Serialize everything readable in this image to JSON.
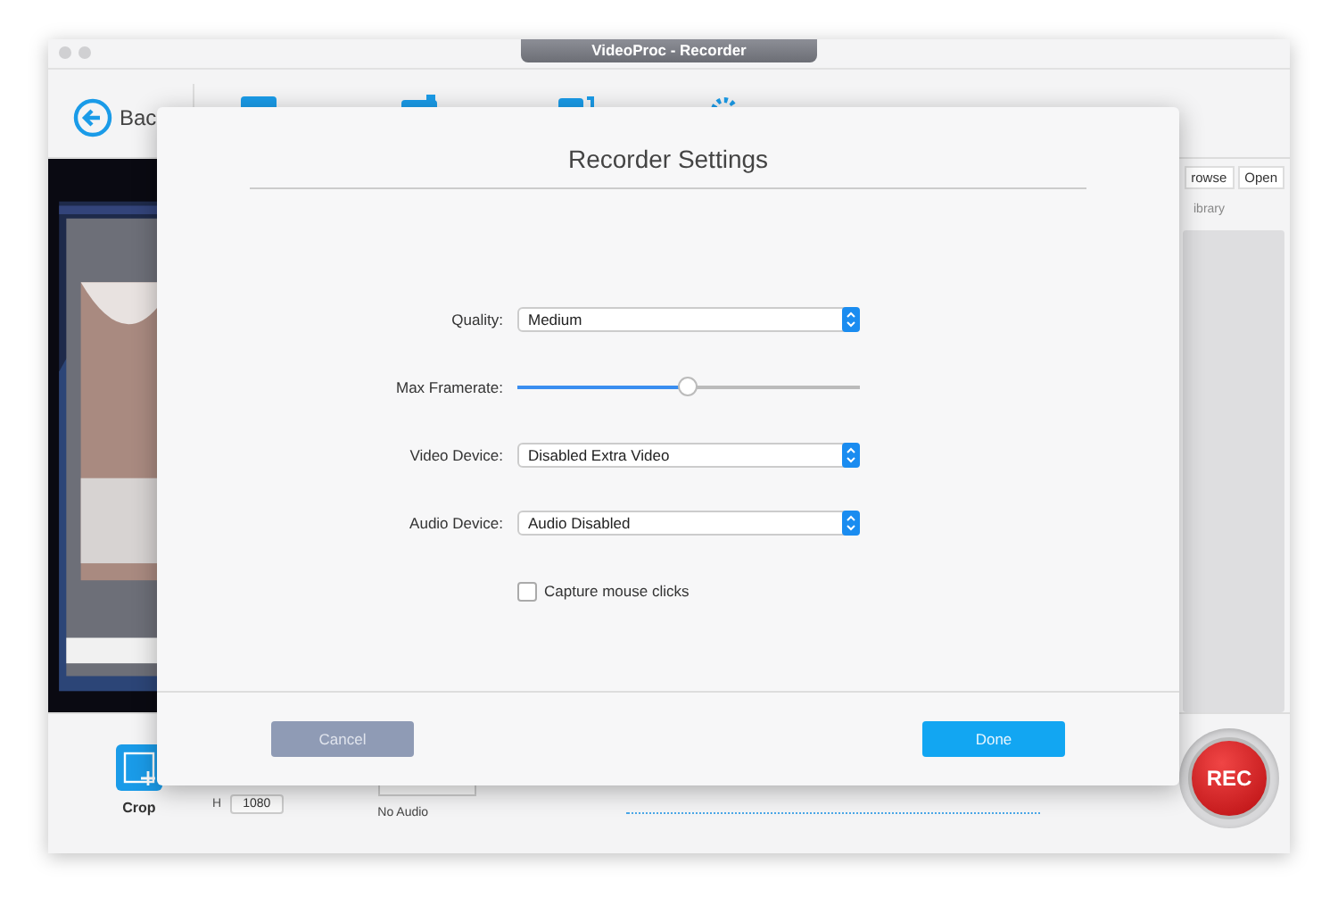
{
  "window": {
    "title": "VideoProc - Recorder"
  },
  "toolbar": {
    "back_label": "Bac"
  },
  "side_panel": {
    "buttons": [
      "rowse",
      "Open"
    ],
    "caption": "ibrary"
  },
  "bottom_bar": {
    "crop_label": "Crop",
    "height_label": "H",
    "height_value": "1080",
    "audio_label": "No Audio",
    "rec_label": "REC"
  },
  "dialog": {
    "title": "Recorder Settings",
    "fields": [
      {
        "kind": "select",
        "label": "Quality:",
        "value": "Medium"
      },
      {
        "kind": "slider",
        "label": "Max Framerate:",
        "level": 0.5
      },
      {
        "kind": "select",
        "label": "Video Device:",
        "value": "Disabled Extra Video"
      },
      {
        "kind": "select",
        "label": "Audio Device:",
        "value": "Audio Disabled"
      },
      {
        "kind": "checkbox",
        "label": "Capture mouse clicks",
        "checked": false
      }
    ],
    "buttons": [
      {
        "label": "Cancel",
        "disabled": true
      },
      {
        "label": "Done",
        "disabled": false
      }
    ]
  }
}
